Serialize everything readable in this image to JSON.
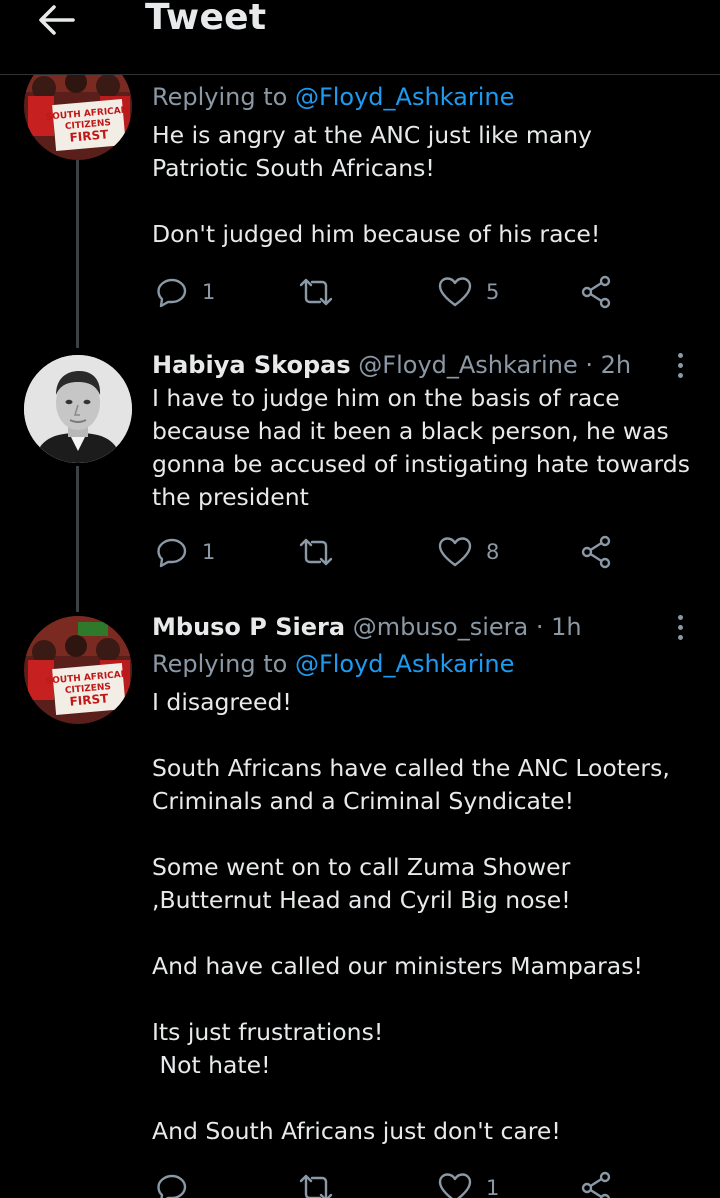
{
  "header": {
    "title": "Tweet",
    "back_icon": "arrow-left-icon"
  },
  "tweets": [
    {
      "replying_prefix": "Replying to ",
      "replying_to": "@Floyd_Ashkarine",
      "text": "He is angry at the ANC just like many Patriotic South Africans!\n\nDon't judged him because of his race!",
      "avatar_text": [
        "SOUTH AFRICAN",
        "CITIZENS",
        "FIRST"
      ],
      "reply_count": "1",
      "retweet_count": "",
      "like_count": "5"
    },
    {
      "name": "Habiya Skopas",
      "handle": "@Floyd_Ashkarine",
      "dot": "·",
      "time": "2h",
      "text": "I have to judge him on the basis of race because had it been a black person, he was gonna be accused of instigating hate towards the president",
      "reply_count": "1",
      "retweet_count": "",
      "like_count": "8"
    },
    {
      "name": "Mbuso P Siera",
      "handle": "@mbuso_siera",
      "dot": "·",
      "time": "1h",
      "replying_prefix": "Replying to ",
      "replying_to": "@Floyd_Ashkarine",
      "avatar_text": [
        "SOUTH AFRICAN",
        "CITIZENS",
        "FIRST"
      ],
      "text": "I disagreed!\n\nSouth Africans have called the ANC Looters, Criminals and a Criminal Syndicate!\n\nSome went on to call Zuma Shower ,Butternut Head and Cyril Big nose!\n\nAnd have called our ministers Mamparas!\n\nIts just frustrations!\n Not hate!\n\nAnd South Africans just don't care!",
      "reply_count": "",
      "retweet_count": "",
      "like_count": "1"
    }
  ],
  "icons": {
    "reply": "reply-icon",
    "retweet": "retweet-icon",
    "like": "heart-icon",
    "share": "share-icon",
    "more": "more-vertical-icon"
  },
  "colors": {
    "background": "#000000",
    "text": "#e7e9ea",
    "secondary": "#8b98a5",
    "link": "#1d9bf0",
    "divider": "#2f3336"
  }
}
